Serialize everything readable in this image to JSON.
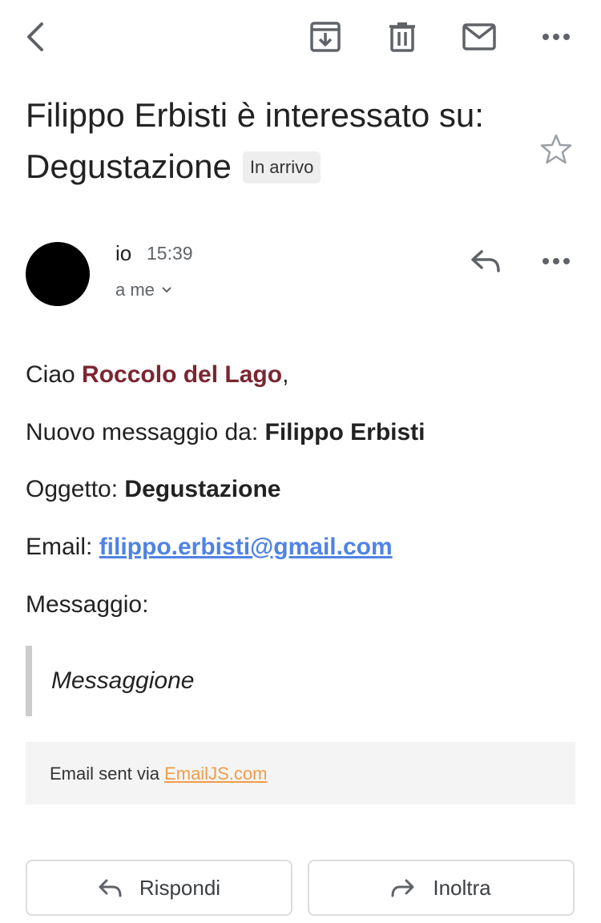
{
  "toolbar": {
    "back_icon": "chevron-left-icon",
    "archive_icon": "archive-icon",
    "delete_icon": "trash-icon",
    "mark_unread_icon": "envelope-icon",
    "more_icon": "more-horizontal-icon"
  },
  "email": {
    "subject": "Filippo Erbisti è interessato su: Degustazione",
    "label": "In arrivo",
    "starred": false
  },
  "sender": {
    "name": "io",
    "time": "15:39",
    "recipients": "a me"
  },
  "body": {
    "greeting_prefix": "Ciao ",
    "greeting_name": "Roccolo del Lago",
    "greeting_suffix": ",",
    "from_label": "Nuovo messaggio da: ",
    "from_value": "Filippo Erbisti",
    "subject_label": "Oggetto: ",
    "subject_value": "Degustazione",
    "email_label": "Email: ",
    "email_value": "filippo.erbisti@gmail.com",
    "message_label": "Messaggio:",
    "message_value": "Messaggione",
    "footer_prefix": "Email sent via ",
    "footer_link": "EmailJS.com"
  },
  "actions": {
    "reply_label": "Rispondi",
    "forward_label": "Inoltra"
  },
  "colors": {
    "brand_name": "#7b2631",
    "link": "#4f83e4",
    "footer_link": "#f19c4b",
    "label_chip_bg": "#eeeeee"
  }
}
